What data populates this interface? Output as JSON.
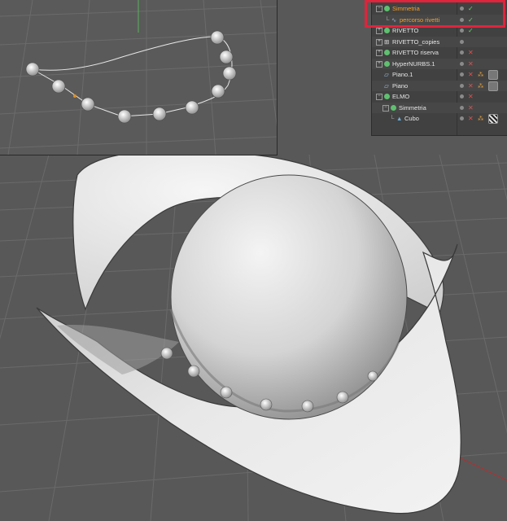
{
  "object_manager": {
    "rows": [
      {
        "label": "Simmetria",
        "icon": "symmetry-icon",
        "highlighted": true,
        "indent": 0
      },
      {
        "label": "percorso rivetti",
        "icon": "spline-icon",
        "highlighted": true,
        "indent": 1
      },
      {
        "label": "RIVETTO",
        "icon": "null-object-icon",
        "highlighted": false,
        "indent": 0
      },
      {
        "label": "RIVETTO_copies",
        "icon": "cloner-icon",
        "highlighted": false,
        "indent": 0
      },
      {
        "label": "RIVETTO riserva",
        "icon": "null-object-icon",
        "highlighted": false,
        "indent": 0
      },
      {
        "label": "HyperNURBS.1",
        "icon": "hypernurbs-icon",
        "highlighted": false,
        "indent": 0
      },
      {
        "label": "Piano.1",
        "icon": "plane-icon",
        "highlighted": false,
        "indent": 0
      },
      {
        "label": "Piano",
        "icon": "plane-icon",
        "highlighted": false,
        "indent": 0
      },
      {
        "label": "ELMO",
        "icon": "null-object-icon",
        "highlighted": false,
        "indent": 0
      },
      {
        "label": "Simmetria",
        "icon": "symmetry-icon",
        "highlighted": false,
        "indent": 1
      },
      {
        "label": "Cubo",
        "icon": "cube-icon",
        "highlighted": false,
        "indent": 2
      }
    ]
  },
  "colors": {
    "accent_highlight": "#f0a030",
    "selection_frame": "#e0243c",
    "viewport_bg": "#555555",
    "panel_bg": "#414141"
  }
}
